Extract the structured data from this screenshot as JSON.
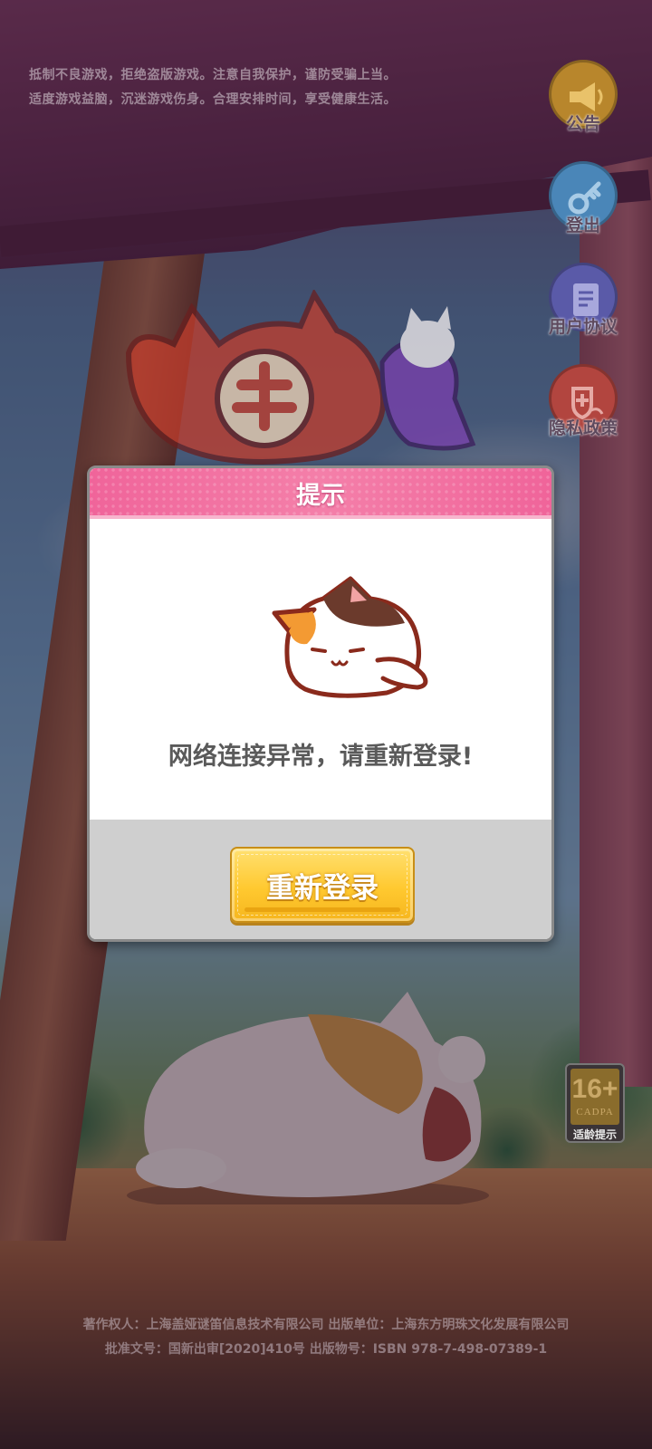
{
  "health_notice": {
    "line1": "抵制不良游戏，拒绝盗版游戏。注意自我保护，谨防受骗上当。",
    "line2": "适度游戏益脑，沉迷游戏伤身。合理安排时间，享受健康生活。"
  },
  "side_menu": {
    "announcement": "公告",
    "logout": "登出",
    "user_agreement": "用户协议",
    "privacy_policy": "隐私政策"
  },
  "dialog": {
    "title": "提示",
    "message": "网络连接异常，请重新登录!",
    "button_label": "重新登录"
  },
  "age_rating": {
    "value": "16+",
    "org": "CADPA",
    "caption": "适龄提示"
  },
  "footer": {
    "line1": "著作权人：上海盖娅谜笛信息技术有限公司 出版单位：上海东方明珠文化发展有限公司",
    "line2": "批准文号：国新出审[2020]410号   出版物号：ISBN 978-7-498-07389-1"
  },
  "colors": {
    "dialog_header": "#f0649a",
    "button": "#ffc930",
    "side_icons": [
      "#b8862c",
      "#4a86b8",
      "#5a5aa8",
      "#b2453f"
    ]
  }
}
